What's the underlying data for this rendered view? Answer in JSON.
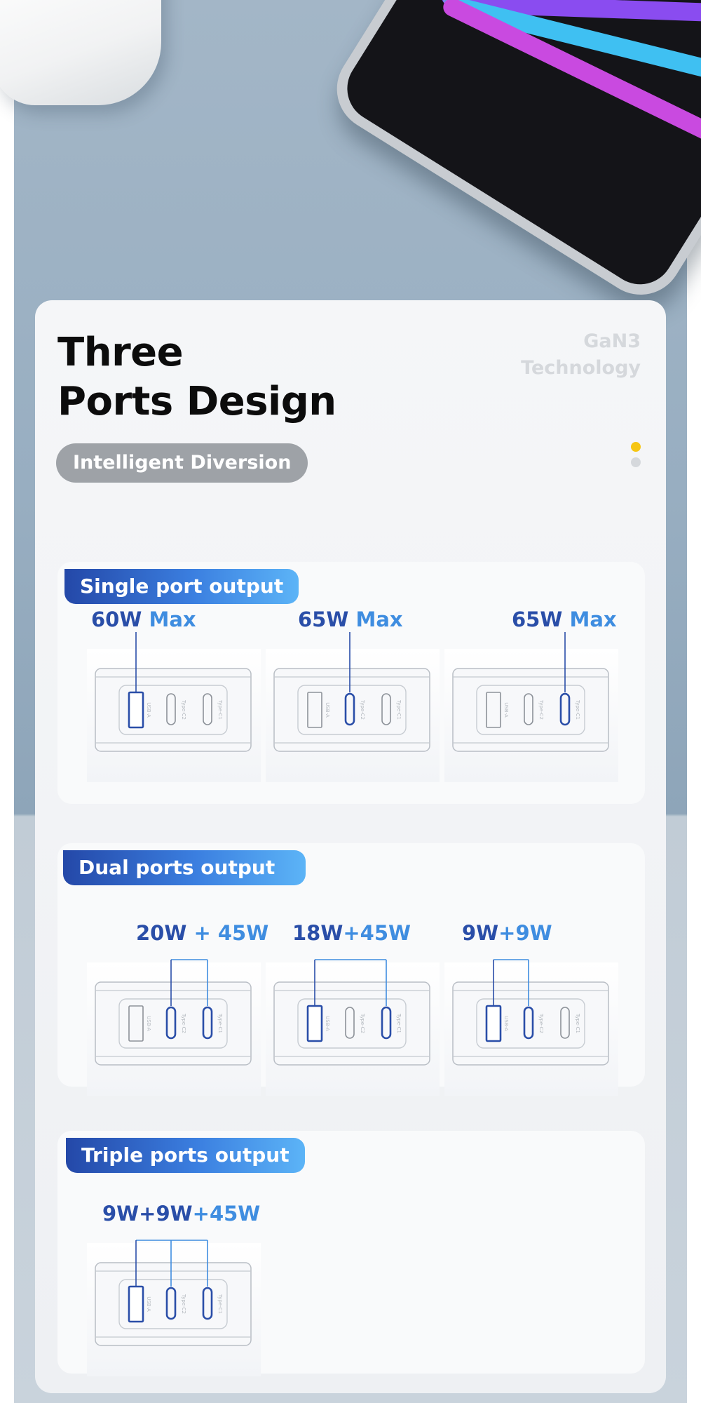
{
  "hero": {
    "title_line1": "Three",
    "title_line2": "Ports Design",
    "badge": "Intelligent Diversion",
    "tech_line1": "GaN3",
    "tech_line2": "Technology"
  },
  "port_labels": {
    "usb_a": "USB-A",
    "type_c2": "Type-C2",
    "type_c1": "Type-C1"
  },
  "colors": {
    "accent_dark": "#2a4ea8",
    "accent_light": "#3f8de0",
    "dot_active": "#f6c613"
  },
  "sections": [
    {
      "label": "Single port output",
      "items": [
        {
          "part1": "60W",
          "part2": " Max",
          "active": [
            "A"
          ]
        },
        {
          "part1": "65W",
          "part2": " Max",
          "active": [
            "C2"
          ]
        },
        {
          "part1": "65W",
          "part2": " Max",
          "active": [
            "C1"
          ]
        }
      ]
    },
    {
      "label": "Dual ports output",
      "items": [
        {
          "part1": "20W",
          "part2": " + 45W",
          "active": [
            "C2",
            "C1"
          ]
        },
        {
          "part1": "18W",
          "part2": "+45W",
          "active": [
            "A",
            "C1"
          ]
        },
        {
          "part1": "9W",
          "part2": "+9W",
          "active": [
            "A",
            "C2"
          ]
        }
      ]
    },
    {
      "label": "Triple ports output",
      "items": [
        {
          "part1": "9W+9W",
          "part2": "+45W",
          "active": [
            "A",
            "C2",
            "C1"
          ]
        }
      ]
    }
  ]
}
